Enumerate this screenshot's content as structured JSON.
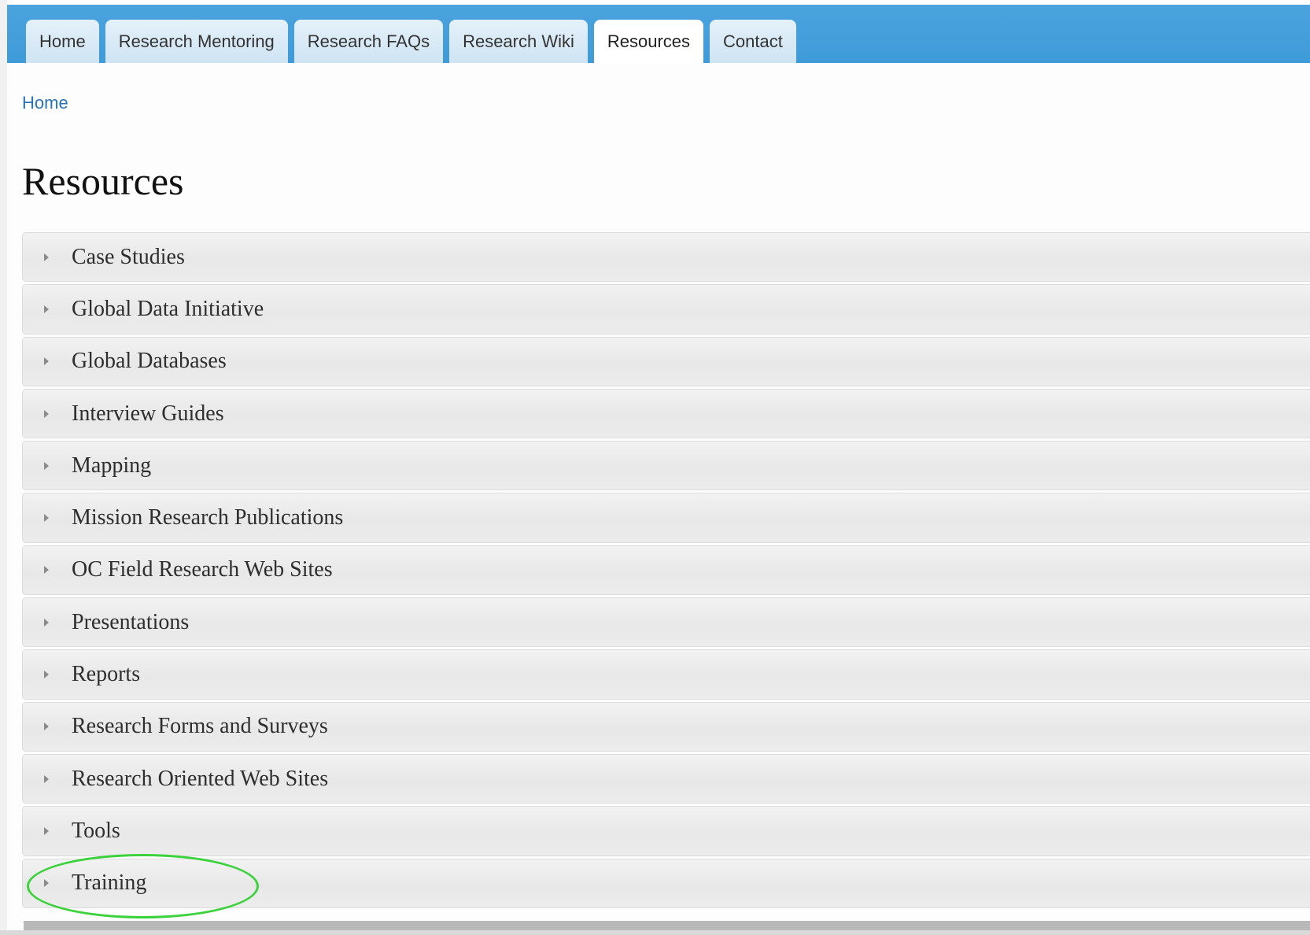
{
  "nav": {
    "tabs": [
      {
        "label": "Home",
        "active": false
      },
      {
        "label": "Research Mentoring",
        "active": false
      },
      {
        "label": "Research FAQs",
        "active": false
      },
      {
        "label": "Research Wiki",
        "active": false
      },
      {
        "label": "Resources",
        "active": true
      },
      {
        "label": "Contact",
        "active": false
      }
    ]
  },
  "breadcrumb": {
    "home": "Home"
  },
  "page": {
    "title": "Resources"
  },
  "accordion": {
    "items": [
      {
        "label": "Case Studies"
      },
      {
        "label": "Global Data Initiative"
      },
      {
        "label": "Global Databases"
      },
      {
        "label": "Interview Guides"
      },
      {
        "label": "Mapping"
      },
      {
        "label": "Mission Research Publications"
      },
      {
        "label": "OC Field Research Web Sites"
      },
      {
        "label": "Presentations"
      },
      {
        "label": "Reports"
      },
      {
        "label": "Research Forms and Surveys"
      },
      {
        "label": "Research Oriented Web Sites"
      },
      {
        "label": "Tools"
      },
      {
        "label": "Training"
      }
    ]
  },
  "annotation": {
    "highlighted_item": "Training",
    "color": "#3bd23b"
  },
  "colors": {
    "nav_bar": "#4aa3dd",
    "tab_inactive": "#d9eaf6",
    "tab_active": "#ffffff",
    "link": "#2a73b8"
  }
}
